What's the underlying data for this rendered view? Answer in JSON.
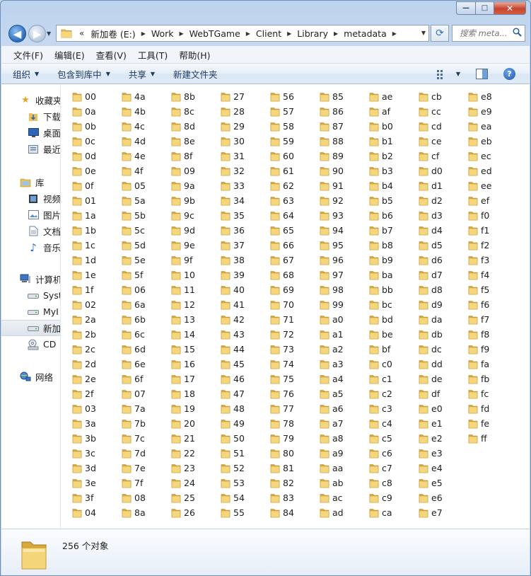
{
  "window": {
    "buttons": {
      "minimize": "—",
      "maximize": "□",
      "close": "✕"
    }
  },
  "address": {
    "overflow": "«",
    "crumbs": [
      "新加卷 (E:)",
      "Work",
      "WebTGame",
      "Client",
      "Library",
      "metadata"
    ],
    "search_placeholder": "搜索 meta..."
  },
  "menu": [
    "文件(F)",
    "编辑(E)",
    "查看(V)",
    "工具(T)",
    "帮助(H)"
  ],
  "toolbar": {
    "organize": "组织",
    "include_library": "包含到库中",
    "share": "共享",
    "new_folder": "新建文件夹"
  },
  "nav": {
    "favorites": {
      "label": "收藏夹",
      "items": [
        "下载",
        "桌面",
        "最近"
      ]
    },
    "libraries": {
      "label": "库",
      "items": [
        "视频",
        "图片",
        "文档",
        "音乐"
      ]
    },
    "computer": {
      "label": "计算机",
      "items": [
        "Syst",
        "MyI",
        "新加",
        "CD"
      ]
    },
    "network": {
      "label": "网络"
    }
  },
  "folders": [
    "00",
    "0a",
    "0b",
    "0c",
    "0d",
    "0e",
    "0f",
    "01",
    "1a",
    "1b",
    "1c",
    "1d",
    "1e",
    "1f",
    "02",
    "2a",
    "2b",
    "2c",
    "2d",
    "2e",
    "2f",
    "03",
    "3a",
    "3b",
    "3c",
    "3d",
    "3e",
    "3f",
    "04",
    "4a",
    "4b",
    "4c",
    "4d",
    "4e",
    "4f",
    "05",
    "5a",
    "5b",
    "5c",
    "5d",
    "5e",
    "5f",
    "06",
    "6a",
    "6b",
    "6c",
    "6d",
    "6e",
    "6f",
    "07",
    "7a",
    "7b",
    "7c",
    "7d",
    "7e",
    "7f",
    "08",
    "8a",
    "8b",
    "8c",
    "8d",
    "8e",
    "8f",
    "09",
    "9a",
    "9b",
    "9c",
    "9d",
    "9e",
    "9f",
    "10",
    "11",
    "12",
    "13",
    "14",
    "15",
    "16",
    "17",
    "18",
    "19",
    "20",
    "21",
    "22",
    "23",
    "24",
    "25",
    "26",
    "27",
    "28",
    "29",
    "30",
    "31",
    "32",
    "33",
    "34",
    "35",
    "36",
    "37",
    "38",
    "39",
    "40",
    "41",
    "42",
    "43",
    "44",
    "45",
    "46",
    "47",
    "48",
    "49",
    "50",
    "51",
    "52",
    "53",
    "54",
    "55",
    "56",
    "57",
    "58",
    "59",
    "60",
    "61",
    "62",
    "63",
    "64",
    "65",
    "66",
    "67",
    "68",
    "69",
    "70",
    "71",
    "72",
    "73",
    "74",
    "75",
    "76",
    "77",
    "78",
    "79",
    "80",
    "81",
    "82",
    "83",
    "84",
    "85",
    "86",
    "87",
    "88",
    "89",
    "90",
    "91",
    "92",
    "93",
    "94",
    "95",
    "96",
    "97",
    "98",
    "99",
    "a0",
    "a1",
    "a2",
    "a3",
    "a4",
    "a5",
    "a6",
    "a7",
    "a8",
    "a9",
    "aa",
    "ab",
    "ac",
    "ad",
    "ae",
    "af",
    "b0",
    "b1",
    "b2",
    "b3",
    "b4",
    "b5",
    "b6",
    "b7",
    "b8",
    "b9",
    "ba",
    "bb",
    "bc",
    "bd",
    "be",
    "bf",
    "c0",
    "c1",
    "c2",
    "c3",
    "c4",
    "c5",
    "c6",
    "c7",
    "c8",
    "c9",
    "ca",
    "cb",
    "cc",
    "cd",
    "ce",
    "cf",
    "d0",
    "d1",
    "d2",
    "d3",
    "d4",
    "d5",
    "d6",
    "d7",
    "d8",
    "d9",
    "da",
    "db",
    "dc",
    "dd",
    "de",
    "df",
    "e0",
    "e1",
    "e2",
    "e3",
    "e4",
    "e5",
    "e6",
    "e7",
    "e8",
    "e9",
    "ea",
    "eb",
    "ec",
    "ed",
    "ee",
    "ef",
    "f0",
    "f1",
    "f2",
    "f3",
    "f4",
    "f5",
    "f6",
    "f7",
    "f8",
    "f9",
    "fa",
    "fb",
    "fc",
    "fd",
    "fe",
    "ff"
  ],
  "status": {
    "count_text": "256 个对象"
  }
}
